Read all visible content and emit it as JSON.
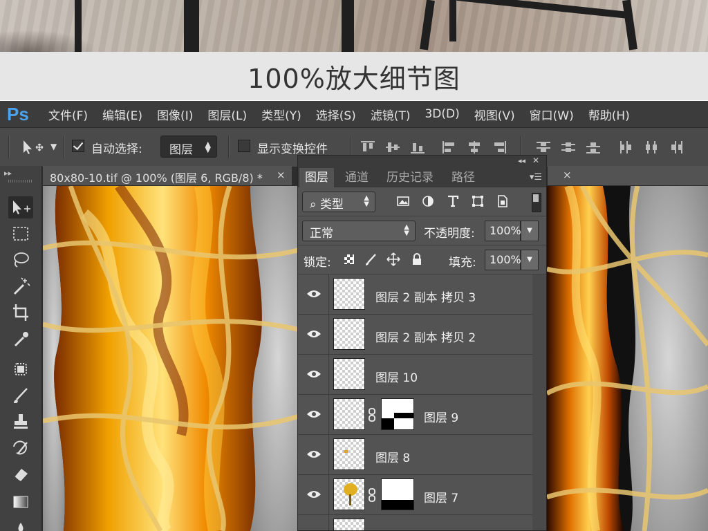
{
  "caption": "100%放大细节图",
  "app": {
    "logo": "Ps",
    "menu": [
      "文件(F)",
      "编辑(E)",
      "图像(I)",
      "图层(L)",
      "类型(Y)",
      "选择(S)",
      "滤镜(T)",
      "3D(D)",
      "视图(V)",
      "窗口(W)",
      "帮助(H)"
    ]
  },
  "options_bar": {
    "auto_select_checked": true,
    "auto_select_label": "自动选择:",
    "auto_select_value": "图层",
    "show_transform_checked": false,
    "show_transform_label": "显示变换控件"
  },
  "document": {
    "tab_title": "80x80-10.tif @ 100% (图层 6, RGB/8) *",
    "close_symbol": "×"
  },
  "layers_panel": {
    "tabs": [
      "图层",
      "通道",
      "历史记录",
      "路径"
    ],
    "active_tab": "图层",
    "filter_label": "类型",
    "blend_mode": "正常",
    "opacity_label": "不透明度:",
    "opacity_value": "100%",
    "lock_label": "锁定:",
    "fill_label": "填充:",
    "fill_value": "100%",
    "layers": [
      {
        "name": "图层 2 副本 拷贝 3",
        "visible": true,
        "mask": null
      },
      {
        "name": "图层 2 副本 拷贝 2",
        "visible": true,
        "mask": null
      },
      {
        "name": "图层 10",
        "visible": true,
        "mask": null
      },
      {
        "name": "图层 9",
        "visible": true,
        "mask": "corner-black"
      },
      {
        "name": "图层 8",
        "visible": true,
        "mask": null
      },
      {
        "name": "图层 7",
        "visible": true,
        "mask": "bottom-black"
      },
      {
        "name": "",
        "visible": true,
        "mask": null
      }
    ]
  },
  "tools": [
    "move-tool",
    "marquee-tool",
    "lasso-tool",
    "magic-wand-tool",
    "crop-tool",
    "eyedropper-tool",
    "healing-brush-tool",
    "brush-tool",
    "clone-stamp-tool",
    "history-brush-tool",
    "eraser-tool",
    "gradient-tool",
    "blur-tool"
  ]
}
